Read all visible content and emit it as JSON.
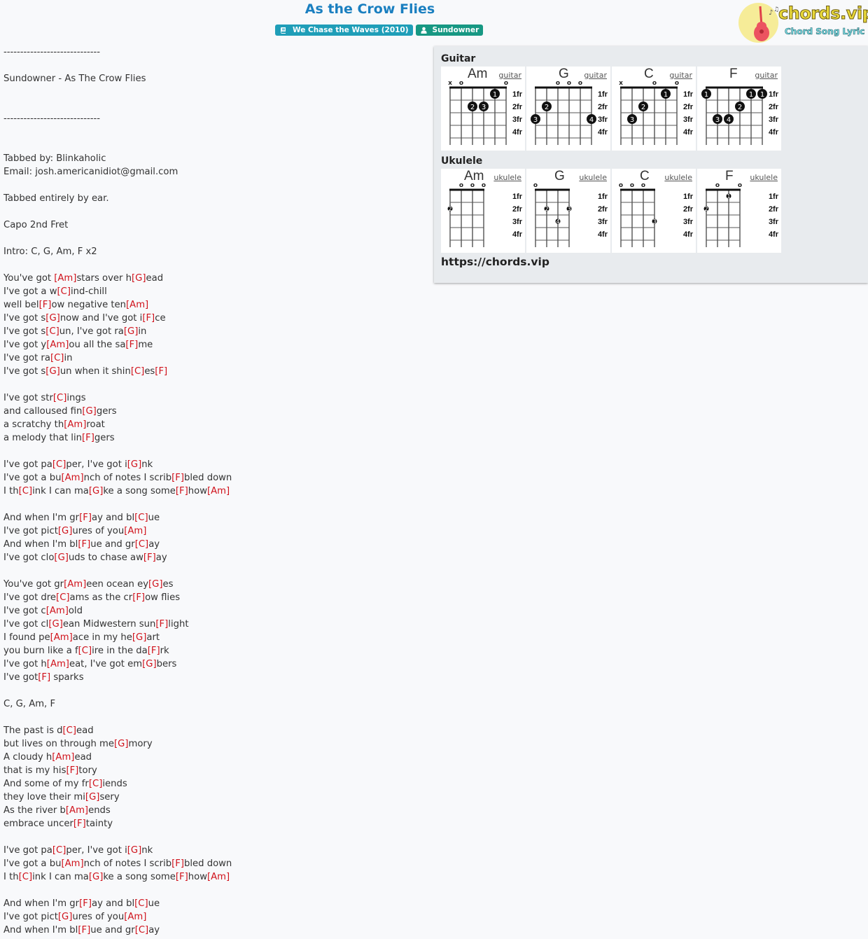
{
  "page": {
    "title": "As the Crow Flies",
    "album_badge": "We Chase the Waves (2010)",
    "artist_badge": "Sundowner",
    "album_icon": "book-icon",
    "artist_icon": "user-icon",
    "title_color": "#1a7fc0",
    "chord_color": "#d0121b"
  },
  "logo": {
    "word": "chords.vip",
    "tagline": "Chord Song Lyric",
    "icon": "guitar-icon"
  },
  "lyrics": [
    "-----------------------------",
    "",
    "Sundowner - As The Crow Flies",
    "",
    "",
    "-----------------------------",
    "",
    "",
    "Tabbed by: Blinkaholic",
    "Email: josh.americanidiot@gmail.com",
    "",
    "Tabbed entirely by ear.",
    "",
    "Capo 2nd Fret",
    "",
    "Intro: C, G, Am, F x2",
    "",
    "You've got [Am]stars over h[G]ead",
    "I've got a w[C]ind-chill",
    "well bel[F]ow negative ten[Am]",
    "I've got s[G]now and I've got i[F]ce",
    "I've got s[C]un, I've got ra[G]in",
    "I've got y[Am]ou all the sa[F]me",
    "I've got ra[C]in",
    "I've got s[G]un when it shin[C]es[F]",
    "",
    "I've got str[C]ings",
    "and calloused fin[G]gers",
    "a scratchy th[Am]roat",
    "a melody that lin[F]gers",
    "",
    "I've got pa[C]per, I've got i[G]nk",
    "I've got a bu[Am]nch of notes I scrib[F]bled down",
    "I th[C]ink I can ma[G]ke a song some[F]how[Am]",
    "",
    "And when I'm gr[F]ay and bl[C]ue",
    "I've got pict[G]ures of you[Am]",
    "And when I'm bl[F]ue and gr[C]ay",
    "I've got clo[G]uds to chase aw[F]ay",
    "",
    "You've got gr[Am]een ocean ey[G]es",
    "I've got dre[C]ams as the cr[F]ow flies",
    "I've got c[Am]old",
    "I've got cl[G]ean Midwestern sun[F]light",
    "I found pe[Am]ace in my he[G]art",
    "you burn like a f[C]ire in the da[F]rk",
    "I've got h[Am]eat, I've got em[G]bers",
    "I've got[F] sparks",
    "",
    "C, G, Am, F",
    "",
    "The past is d[C]ead",
    "but lives on through me[G]mory",
    "A cloudy h[Am]ead",
    "that is my his[F]tory",
    "And some of my fr[C]iends",
    "they love their mi[G]sery",
    "As the river b[Am]ends",
    "embrace uncer[F]tainty",
    "",
    "I've got pa[C]per, I've got i[G]nk",
    "I've got a bu[Am]nch of notes I scrib[F]bled down",
    "I th[C]ink I can ma[G]ke a song some[F]how[Am]",
    "",
    "And when I'm gr[F]ay and bl[C]ue",
    "I've got pict[G]ures of you[Am]",
    "And when I'm bl[F]ue and gr[C]ay"
  ],
  "panel": {
    "guitar_heading": "Guitar",
    "ukulele_heading": "Ukulele",
    "site_url": "https://chords.vip",
    "fret_labels": [
      "1fr",
      "2fr",
      "3fr",
      "4fr"
    ],
    "guitar": [
      {
        "name": "Am",
        "link": "guitar",
        "markers": [
          "x",
          "o",
          "",
          "",
          "",
          "o"
        ],
        "dots": [
          {
            "string": 5,
            "fret": 1,
            "finger": "1"
          },
          {
            "string": 3,
            "fret": 2,
            "finger": "2"
          },
          {
            "string": 4,
            "fret": 2,
            "finger": "3"
          }
        ]
      },
      {
        "name": "G",
        "link": "guitar",
        "markers": [
          "",
          "",
          "o",
          "o",
          "o",
          ""
        ],
        "dots": [
          {
            "string": 2,
            "fret": 2,
            "finger": "2"
          },
          {
            "string": 1,
            "fret": 3,
            "finger": "3"
          },
          {
            "string": 6,
            "fret": 3,
            "finger": "4"
          }
        ]
      },
      {
        "name": "C",
        "link": "guitar",
        "markers": [
          "x",
          "",
          "",
          "o",
          "",
          "o"
        ],
        "dots": [
          {
            "string": 5,
            "fret": 1,
            "finger": "1"
          },
          {
            "string": 3,
            "fret": 2,
            "finger": "2"
          },
          {
            "string": 2,
            "fret": 3,
            "finger": "3"
          }
        ]
      },
      {
        "name": "F",
        "link": "guitar",
        "markers": [
          "",
          "",
          "",
          "",
          "",
          ""
        ],
        "dots": [
          {
            "string": 1,
            "fret": 1,
            "finger": "1"
          },
          {
            "string": 5,
            "fret": 1,
            "finger": "1"
          },
          {
            "string": 6,
            "fret": 1,
            "finger": "1"
          },
          {
            "string": 4,
            "fret": 2,
            "finger": "2"
          },
          {
            "string": 2,
            "fret": 3,
            "finger": "3"
          },
          {
            "string": 3,
            "fret": 3,
            "finger": "4"
          }
        ]
      }
    ],
    "ukulele": [
      {
        "name": "Am",
        "link": "ukulele",
        "markers": [
          "",
          "o",
          "o",
          "o"
        ],
        "dots": [
          {
            "string": 1,
            "fret": 2,
            "finger": "2"
          }
        ]
      },
      {
        "name": "G",
        "link": "ukulele",
        "markers": [
          "o",
          "",
          "",
          ""
        ],
        "dots": [
          {
            "string": 2,
            "fret": 2,
            "finger": "2"
          },
          {
            "string": 4,
            "fret": 2,
            "finger": "3"
          },
          {
            "string": 3,
            "fret": 3,
            "finger": "4"
          }
        ]
      },
      {
        "name": "C",
        "link": "ukulele",
        "markers": [
          "o",
          "o",
          "o",
          ""
        ],
        "dots": [
          {
            "string": 4,
            "fret": 3,
            "finger": "3"
          }
        ]
      },
      {
        "name": "F",
        "link": "ukulele",
        "markers": [
          "",
          "o",
          "",
          "o"
        ],
        "dots": [
          {
            "string": 3,
            "fret": 1,
            "finger": "1"
          },
          {
            "string": 1,
            "fret": 2,
            "finger": "2"
          }
        ]
      }
    ]
  }
}
